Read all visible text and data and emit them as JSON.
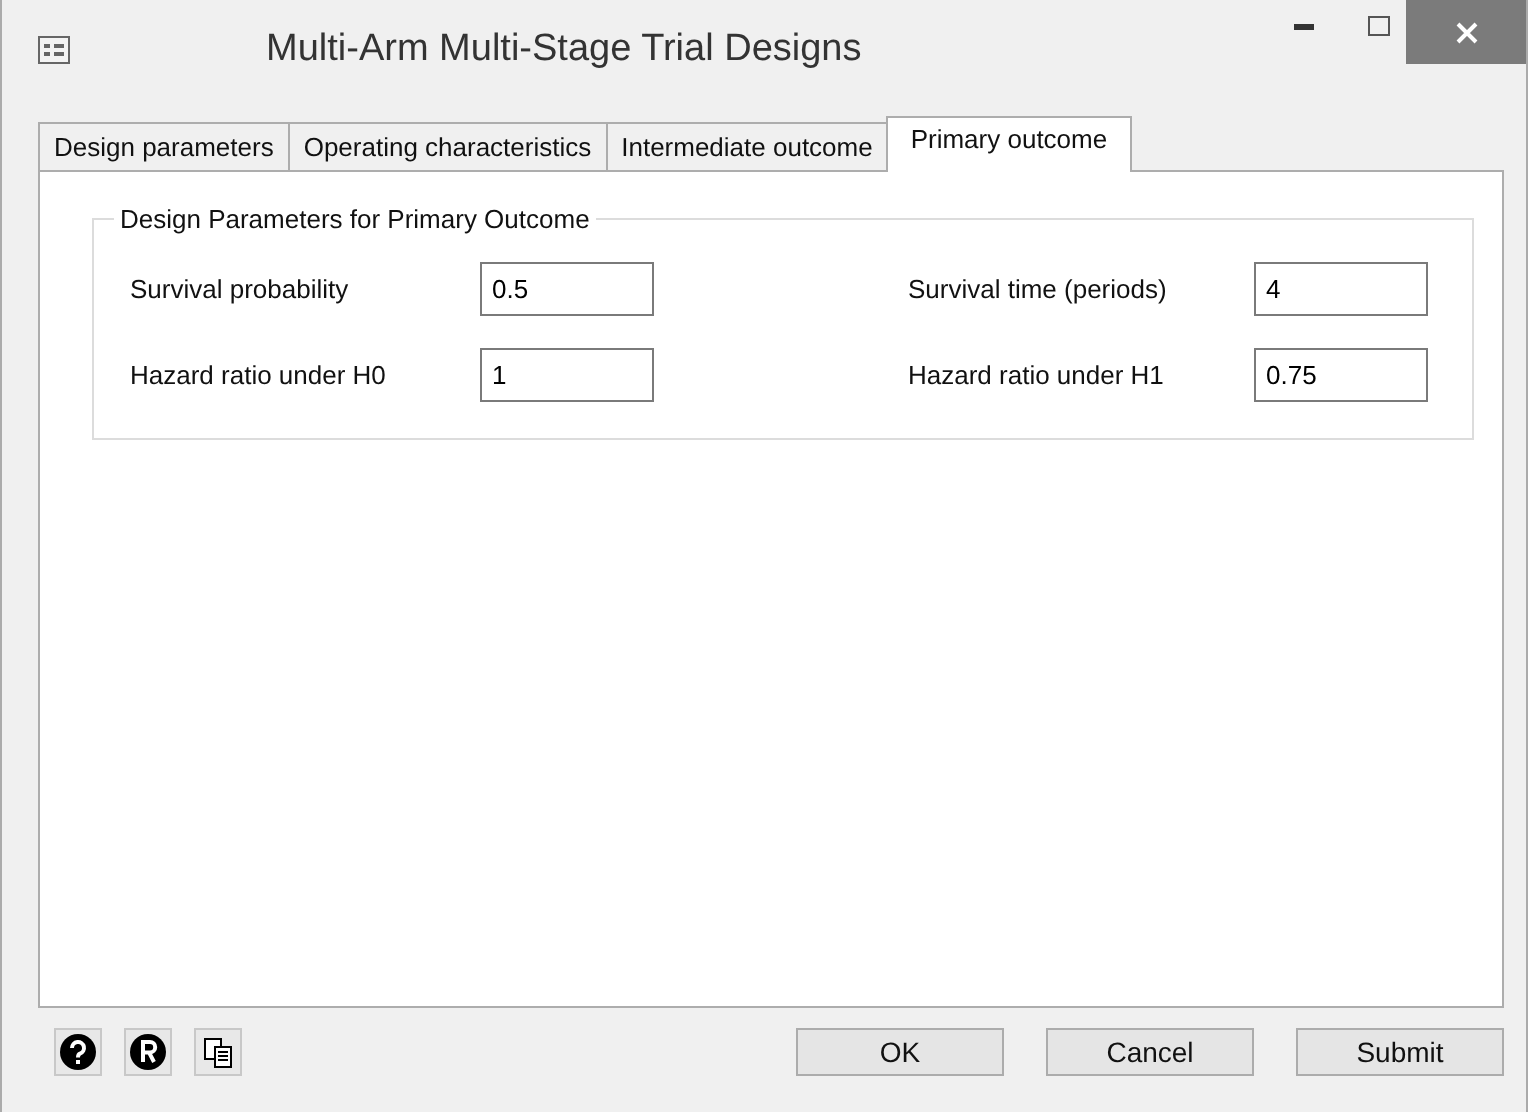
{
  "window": {
    "title": "Multi-Arm Multi-Stage Trial Designs"
  },
  "tabs": [
    {
      "label": "Design parameters",
      "selected": false
    },
    {
      "label": "Operating characteristics",
      "selected": false
    },
    {
      "label": "Intermediate outcome",
      "selected": false
    },
    {
      "label": "Primary outcome",
      "selected": true
    }
  ],
  "group": {
    "title": "Design Parameters for Primary Outcome",
    "fields": [
      {
        "label": "Survival probability",
        "value": "0.5"
      },
      {
        "label": "Survival time (periods)",
        "value": "4"
      },
      {
        "label": "Hazard ratio under H0",
        "value": "1"
      },
      {
        "label": "Hazard ratio under H1",
        "value": "0.75"
      }
    ]
  },
  "buttons": [
    "OK",
    "Cancel",
    "Submit"
  ]
}
